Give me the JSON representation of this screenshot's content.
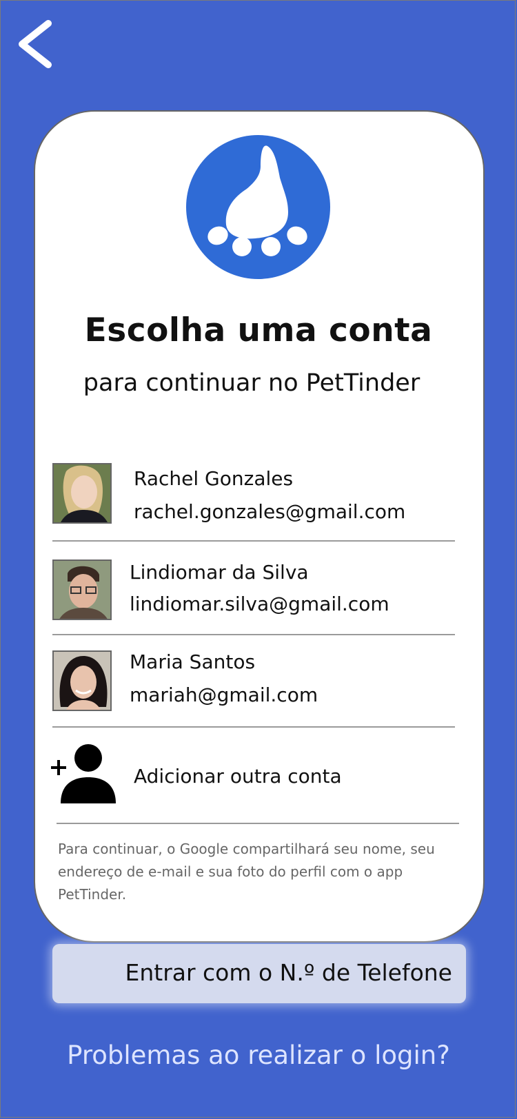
{
  "header": {
    "back_icon": "chevron-left-icon"
  },
  "logo": {
    "icon": "paw-icon",
    "color": "#2f6bd6"
  },
  "title": "Escolha uma conta",
  "subtitle": "para continuar no PetTinder",
  "accounts": [
    {
      "name": "Rachel Gonzales",
      "email": "rachel.gonzales@gmail.com"
    },
    {
      "name": "Lindiomar da Silva",
      "email": "lindiomar.silva@gmail.com"
    },
    {
      "name": "Maria Santos",
      "email": "mariah@gmail.com"
    }
  ],
  "add_account": {
    "label": "Adicionar outra conta",
    "icon": "add-person-icon"
  },
  "note": "Para continuar, o Google compartilhará seu nome, seu endereço de e-mail e sua foto do perfil com o app PetTinder.",
  "phone_button": {
    "label": "Entrar com o N.º de Telefone"
  },
  "problems_link": "Problemas ao realizar o login?",
  "colors": {
    "background": "#4163cd",
    "card": "#ffffff",
    "phone_button": "#d4daee",
    "link": "#dde4ff"
  }
}
